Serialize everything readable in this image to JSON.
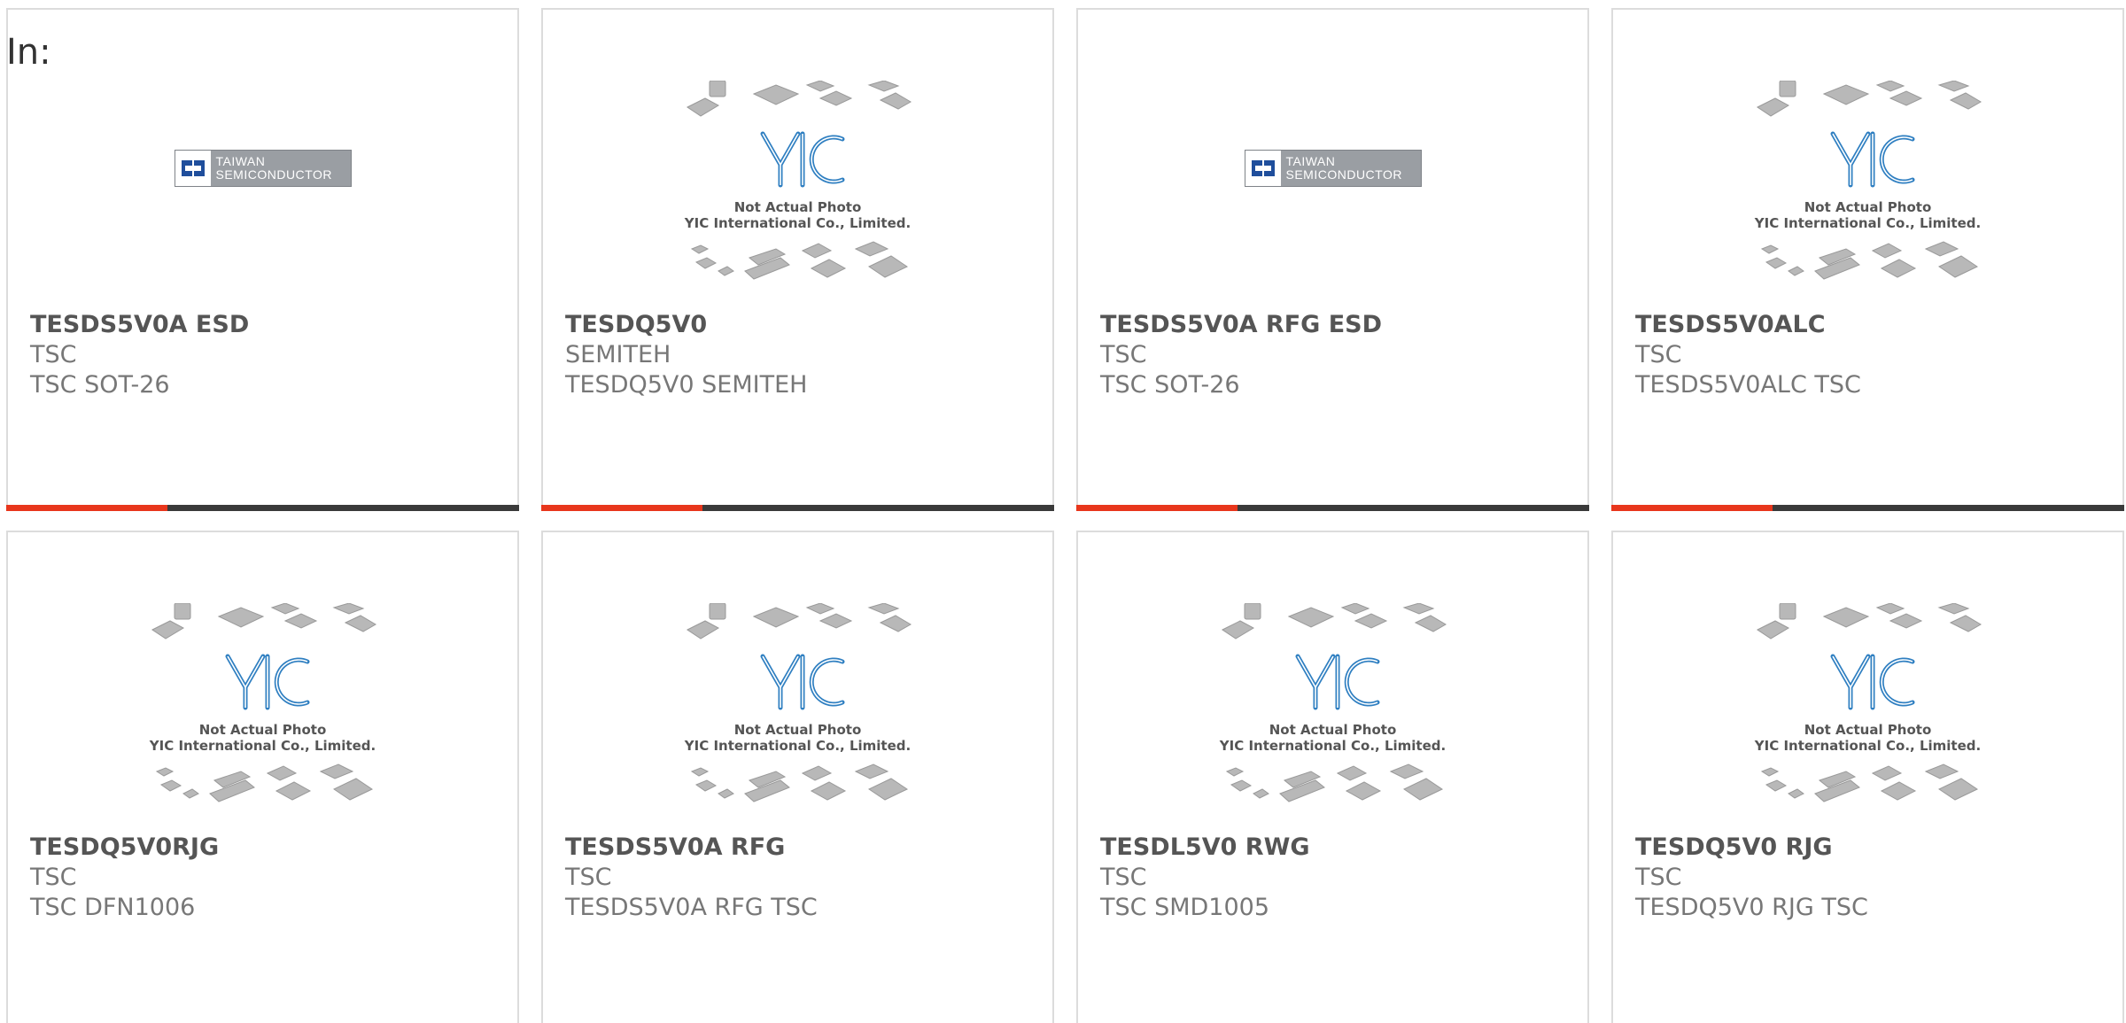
{
  "filter_label": "In:",
  "colors": {
    "accent": "#e8361c",
    "bar": "#3a3a3a",
    "border": "#dcdcdc",
    "title": "#555555",
    "text": "#777777",
    "yic_blue": "#2f7fc1"
  },
  "logos": {
    "tsc_line1": "TAIWAN",
    "tsc_line2": "SEMICONDUCTOR",
    "yic_note_line1": "Not Actual Photo",
    "yic_note_line2": "YIC International Co., Limited."
  },
  "products": [
    {
      "title": "TESDS5V0A ESD",
      "maker": "TSC",
      "desc": "TSC SOT-26",
      "image": "tsc-logo"
    },
    {
      "title": "TESDQ5V0",
      "maker": "SEMITEH",
      "desc": "TESDQ5V0 SEMITEH",
      "image": "yic-placeholder"
    },
    {
      "title": "TESDS5V0A RFG ESD",
      "maker": "TSC",
      "desc": "TSC SOT-26",
      "image": "tsc-logo"
    },
    {
      "title": "TESDS5V0ALC",
      "maker": "TSC",
      "desc": "TESDS5V0ALC TSC",
      "image": "yic-placeholder"
    },
    {
      "title": "TESDQ5V0RJG",
      "maker": "TSC",
      "desc": "TSC DFN1006",
      "image": "yic-placeholder"
    },
    {
      "title": "TESDS5V0A RFG",
      "maker": "TSC",
      "desc": "TESDS5V0A RFG TSC",
      "image": "yic-placeholder"
    },
    {
      "title": "TESDL5V0 RWG",
      "maker": "TSC",
      "desc": "TSC SMD1005",
      "image": "yic-placeholder"
    },
    {
      "title": "TESDQ5V0 RJG",
      "maker": "TSC",
      "desc": "TESDQ5V0 RJG TSC",
      "image": "yic-placeholder"
    }
  ]
}
